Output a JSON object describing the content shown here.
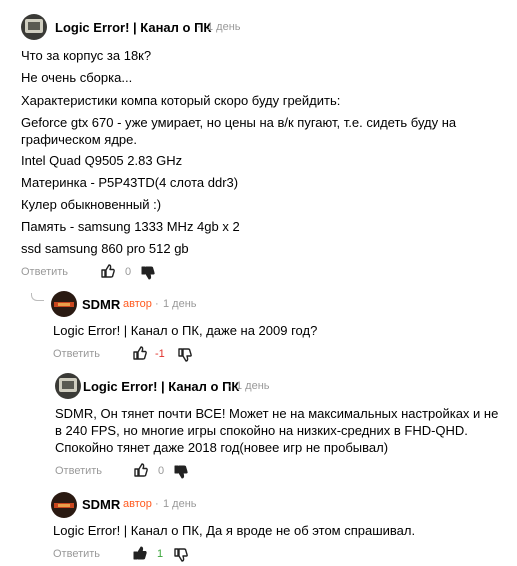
{
  "comments": [
    {
      "author": "Logic Error! | Канал о ПК",
      "time": "1 день",
      "lines": [
        "Что за корпус за 18к?",
        "Не очень сборка...",
        "Характеристики компа который скоро буду грейдить:",
        "Geforce gtx 670 - уже умирает, но цены на в/к пугают, т.е. сидеть буду на графическом ядре.",
        "Intel Quad Q9505 2.83 GHz",
        "Материнка - P5P43TD(4 слота ddr3)",
        "Кулер обыкновенный :)",
        "Память - samsung 1333 MHz 4gb x 2",
        "ssd samsung 860 pro 512 gb"
      ],
      "reply_label": "Ответить",
      "votes": "0",
      "vote_color": "#999999"
    },
    {
      "author": "SDMR",
      "badge": "автор",
      "time": "1 день",
      "lines": [
        "Logic Error! | Канал о ПК, даже на 2009 год?"
      ],
      "reply_label": "Ответить",
      "votes": "-1",
      "vote_color": "#e0302a"
    },
    {
      "author": "Logic Error! | Канал о ПК",
      "time": "1 день",
      "lines": [
        "SDMR, Он тянет почти ВСЕ! Может не на максимальных настройках и не в 240 FPS, но многие игры спокойно на низких-средних в FHD-QHD. Спокойно тянет даже 2018 год(новее игр не пробывал)"
      ],
      "reply_label": "Ответить",
      "votes": "0",
      "vote_color": "#999999"
    },
    {
      "author": "SDMR",
      "badge": "автор",
      "time": "1 день",
      "lines": [
        "Logic Error! | Канал о ПК, Да я вроде не об этом спрашивал."
      ],
      "reply_label": "Ответить",
      "votes": "1",
      "vote_color": "#3aa53a"
    }
  ],
  "icons": {
    "like": "thumbs-up-icon",
    "dislike": "thumbs-down-icon"
  }
}
